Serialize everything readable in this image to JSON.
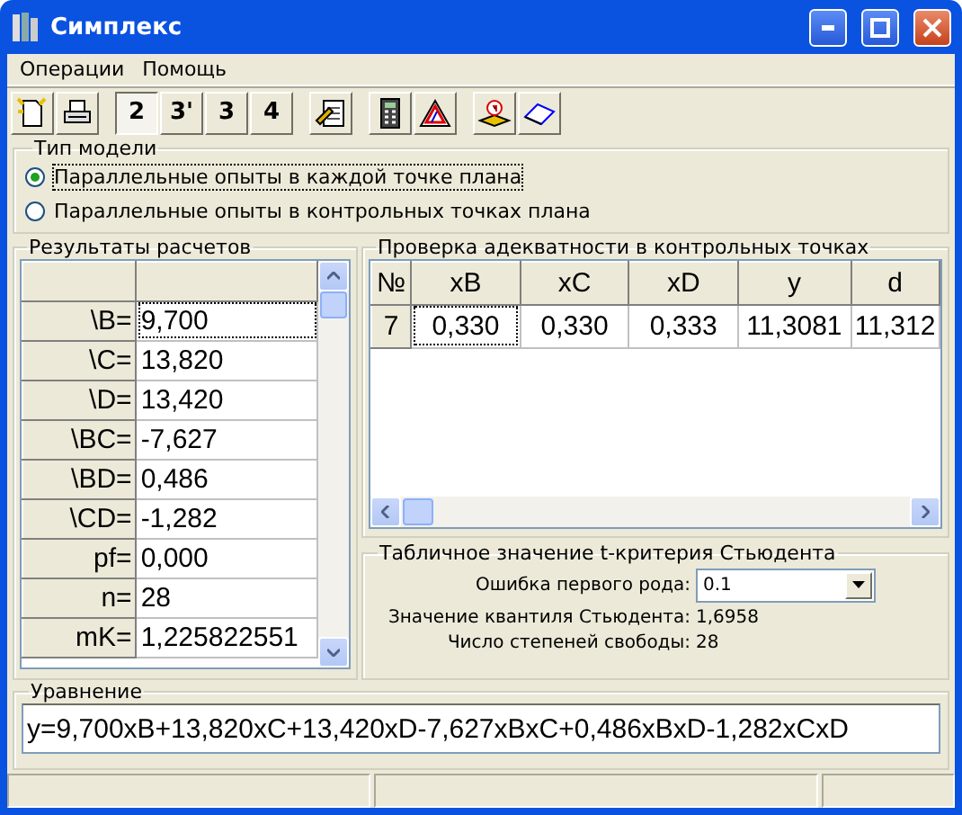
{
  "window": {
    "title": "Симплекс"
  },
  "menu": [
    {
      "label": "Операции"
    },
    {
      "label": "Помощь"
    }
  ],
  "model_buttons": [
    {
      "label": "2",
      "selected": true
    },
    {
      "label": "3'",
      "selected": false
    },
    {
      "label": "3",
      "selected": false
    },
    {
      "label": "4",
      "selected": false
    }
  ],
  "model_type": {
    "title": "Тип модели",
    "options": [
      {
        "label": "Параллельные опыты в каждой точке плана",
        "selected": true
      },
      {
        "label": "Параллельные опыты в контрольных точках плана",
        "selected": false
      }
    ]
  },
  "results": {
    "title": "Результаты расчетов",
    "rows": [
      {
        "name": "\\B=",
        "value": "9,700"
      },
      {
        "name": "\\C=",
        "value": "13,820"
      },
      {
        "name": "\\D=",
        "value": "13,420"
      },
      {
        "name": "\\BC=",
        "value": "-7,627"
      },
      {
        "name": "\\BD=",
        "value": "0,486"
      },
      {
        "name": "\\CD=",
        "value": "-1,282"
      },
      {
        "name": "pf=",
        "value": "0,000"
      },
      {
        "name": "n=",
        "value": "28"
      },
      {
        "name": "mK=",
        "value": "1,225822551"
      }
    ]
  },
  "adequacy": {
    "title": "Проверка адекватности в контрольных точках",
    "columns": [
      "№",
      "xB",
      "xC",
      "xD",
      "y",
      "d"
    ],
    "rows": [
      [
        "7",
        "0,330",
        "0,330",
        "0,333",
        "11,3081",
        "11,312"
      ]
    ]
  },
  "student": {
    "title": "Табличное значение  t-критерия Стьюдента",
    "error_label": "Ошибка первого рода:",
    "error_value": "0.1",
    "quantile_label": "Значение квантиля Стьюдента:",
    "quantile_value": "1,6958",
    "dof_label": "Число степеней свободы:",
    "dof_value": "28"
  },
  "equation": {
    "title": "Уравнение",
    "value": "y=9,700xB+13,820xC+13,420xD-7,627xBxC+0,486xBxD-1,282xCxD"
  }
}
